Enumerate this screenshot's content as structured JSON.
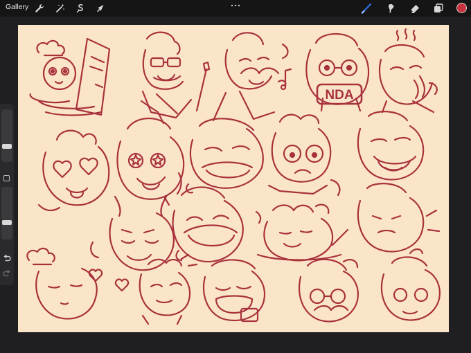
{
  "topbar": {
    "gallery_label": "Gallery",
    "left_tools": [
      "wrench-icon",
      "magic-wand-icon",
      "selection-icon",
      "transform-arrow-icon"
    ],
    "right_tools": [
      "brush-icon",
      "smudge-icon",
      "eraser-icon",
      "layers-icon"
    ]
  },
  "colors": {
    "active_color": "#c8323c",
    "brush_tool_accent": "#2f6fe0",
    "canvas_background": "#fbe5c8",
    "sketch_stroke": "#a8323c"
  },
  "sidebar": {
    "brush_size": 0.28,
    "brush_opacity": 0.3,
    "icons": [
      "modify-square-icon",
      "undo-icon",
      "redo-icon"
    ]
  },
  "canvas": {
    "note_badge": "NDA"
  }
}
